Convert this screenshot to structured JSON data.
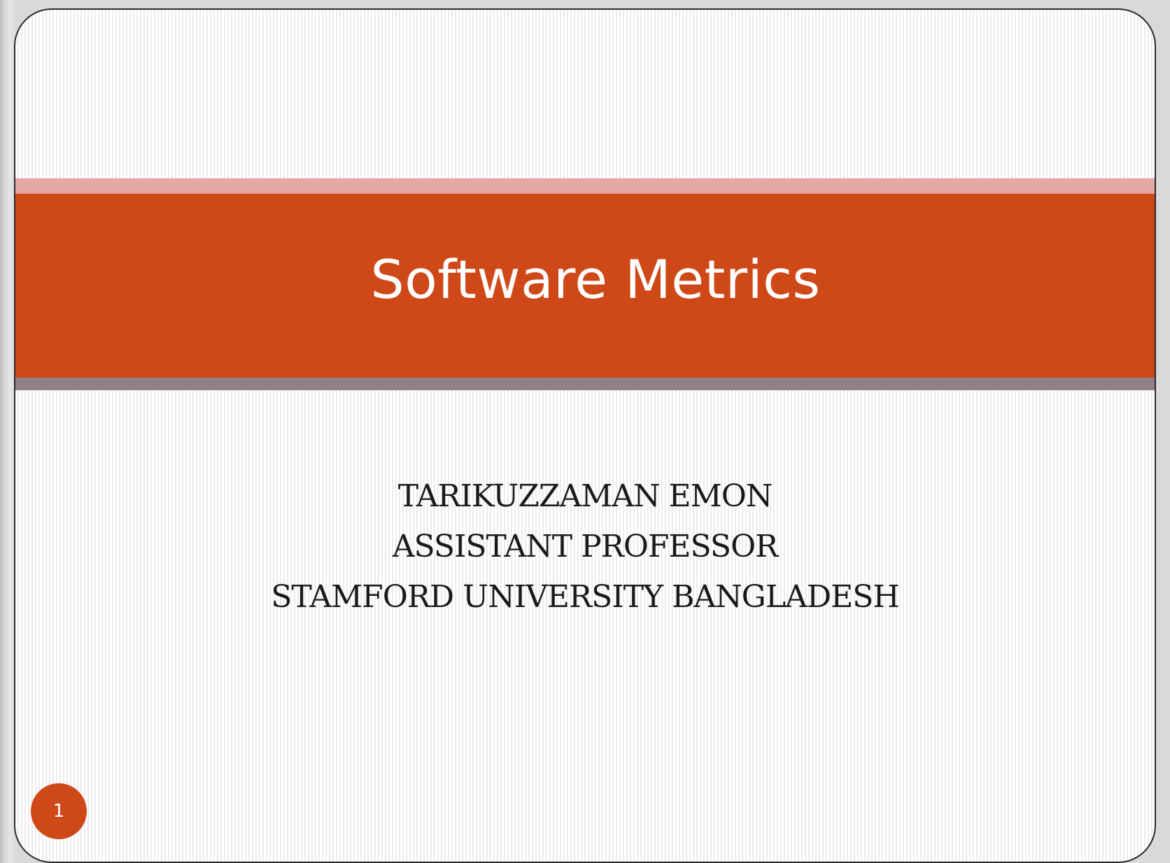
{
  "slide": {
    "title": "Software Metrics",
    "subtitle_lines": [
      "TARIKUZZAMAN EMON",
      "ASSISTANT PROFESSOR",
      "STAMFORD UNIVERSITY BANGLADESH"
    ],
    "slide_number": "1"
  },
  "colors": {
    "accent": "#cf4818",
    "band_light": "#e3a8a3",
    "band_dark": "#8f8184",
    "title_text": "#ffffff",
    "body_text": "#1a1a1a"
  }
}
